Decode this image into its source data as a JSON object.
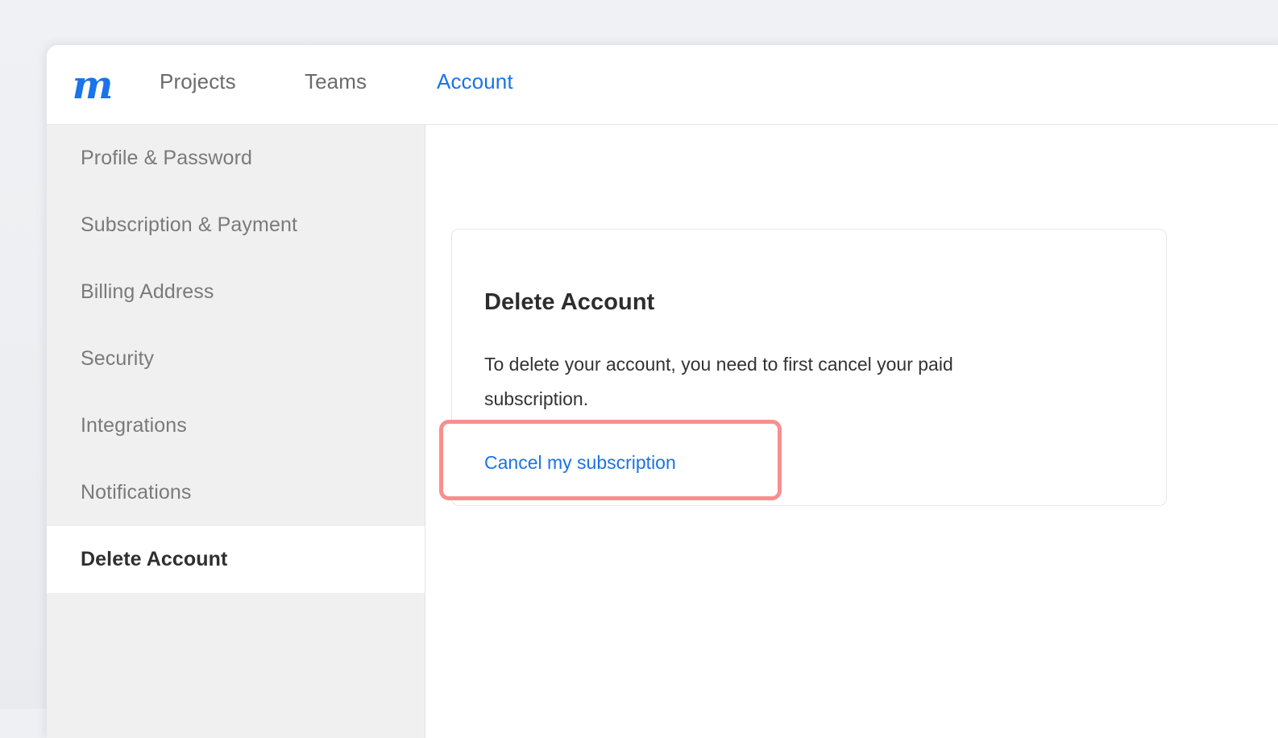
{
  "brand": {
    "logo_glyph": "m",
    "logo_name": "mural-logo",
    "accent_color": "#1a73e8"
  },
  "top_nav": {
    "tabs": [
      {
        "label": "Projects",
        "active": false
      },
      {
        "label": "Teams",
        "active": false
      },
      {
        "label": "Account",
        "active": true
      }
    ]
  },
  "sidebar": {
    "items": [
      {
        "label": "Profile & Password",
        "active": false
      },
      {
        "label": "Subscription & Payment",
        "active": false
      },
      {
        "label": "Billing Address",
        "active": false
      },
      {
        "label": "Security",
        "active": false
      },
      {
        "label": "Integrations",
        "active": false
      },
      {
        "label": "Notifications",
        "active": false
      },
      {
        "label": "Delete Account",
        "active": true
      }
    ]
  },
  "main": {
    "card": {
      "heading": "Delete Account",
      "body": "To delete your account, you need to first cancel your paid subscription.",
      "link_label": "Cancel my subscription"
    },
    "highlight": {
      "target": "Cancel my subscription",
      "border_color": "#fa8e8e"
    }
  },
  "colors": {
    "page_background": "#eef0f3",
    "sidebar_background": "#f0f0f0",
    "card_border": "#e8e8e8",
    "link": "#1a73e8",
    "muted_text": "#7a7a7a",
    "heading_text": "#2d2d2d"
  }
}
